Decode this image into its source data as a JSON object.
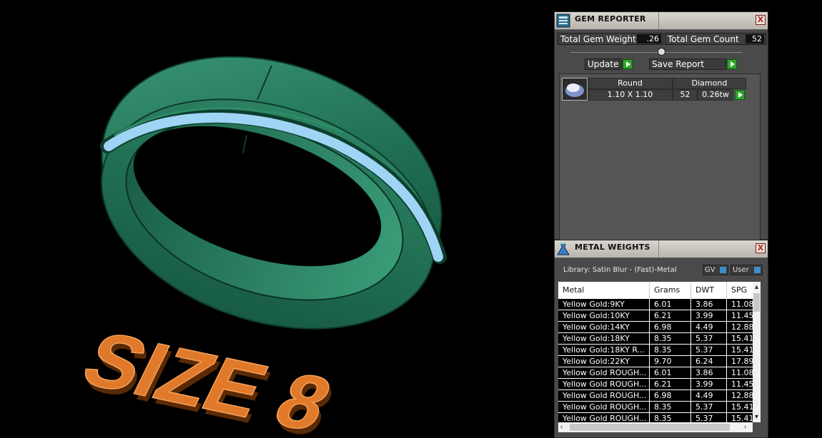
{
  "viewport": {
    "caption": "SIZE 8",
    "ring_color": "#2a7a5a",
    "gem_color": "#9fd4f5",
    "caption_color": "#e07a2a"
  },
  "gem_reporter": {
    "title": "GEM REPORTER",
    "close": "X",
    "total_gem_weight_label": "Total Gem Weight",
    "total_gem_weight": ".26",
    "total_gem_count_label": "Total Gem Count",
    "total_gem_count": "52",
    "update_label": "Update",
    "save_report_label": "Save Report",
    "gems": [
      {
        "shape": "Round",
        "material": "Diamond",
        "size": "1.10 X 1.10",
        "count": "52",
        "weight": "0.26tw"
      }
    ]
  },
  "metal_weights": {
    "title": "METAL WEIGHTS",
    "close": "X",
    "library": "Library: Satin Blur - (Fast)-Metal",
    "gv_label": "GV",
    "user_label": "User",
    "columns": [
      "Metal",
      "Grams",
      "DWT",
      "SPG"
    ],
    "rows": [
      [
        "Yellow Gold:9KY",
        "6.01",
        "3.86",
        "11.08"
      ],
      [
        "Yellow Gold:10KY",
        "6.21",
        "3.99",
        "11.45"
      ],
      [
        "Yellow Gold:14KY",
        "6.98",
        "4.49",
        "12.88"
      ],
      [
        "Yellow Gold:18KY",
        "8.35",
        "5.37",
        "15.41"
      ],
      [
        "Yellow Gold:18KY R...",
        "8.35",
        "5.37",
        "15.41"
      ],
      [
        "Yellow Gold:22KY",
        "9.70",
        "6.24",
        "17.89"
      ],
      [
        "Yellow Gold ROUGH...",
        "6.01",
        "3.86",
        "11.08"
      ],
      [
        "Yellow Gold ROUGH...",
        "6.21",
        "3.99",
        "11.45"
      ],
      [
        "Yellow Gold ROUGH...",
        "6.98",
        "4.49",
        "12.88"
      ],
      [
        "Yellow Gold ROUGH...",
        "8.35",
        "5.37",
        "15.41"
      ],
      [
        "Yellow Gold ROUGH...",
        "8.35",
        "5.37",
        "15.41"
      ]
    ]
  }
}
